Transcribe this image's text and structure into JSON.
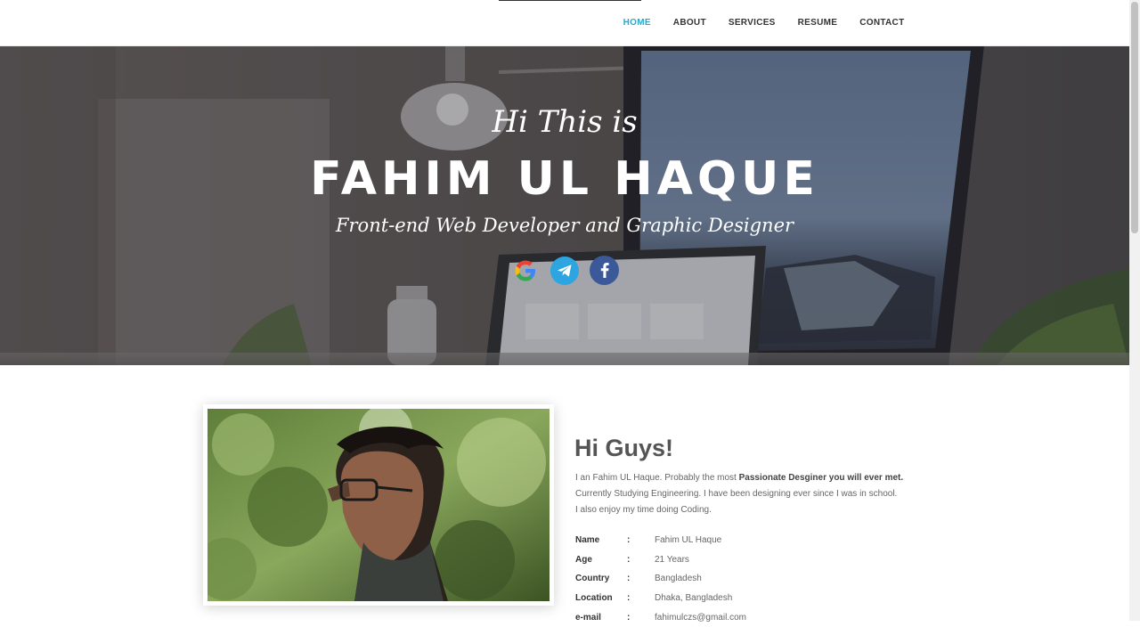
{
  "nav": {
    "items": [
      {
        "label": "HOME",
        "active": true
      },
      {
        "label": "ABOUT",
        "active": false
      },
      {
        "label": "SERVICES",
        "active": false
      },
      {
        "label": "RESUME",
        "active": false
      },
      {
        "label": "CONTACT",
        "active": false
      }
    ],
    "active_color": "#29a9c9"
  },
  "hero": {
    "greeting": "Hi This is",
    "name": "FAHIM UL HAQUE",
    "tagline": "Front-end Web Developer and Graphic Designer",
    "social": [
      "google-icon",
      "telegram-icon",
      "facebook-icon"
    ]
  },
  "about": {
    "title": "Hi Guys!",
    "intro_part1": "I an Fahim UL Haque. Probably the most ",
    "intro_bold": "Passionate Desginer you will ever met.",
    "intro_part2": " Currently Studying Engineering. I have been designing ever since I was in school.",
    "intro_line3": "I also enjoy my time doing Coding.",
    "colon": ":",
    "info": [
      {
        "label": "Name",
        "value": "Fahim UL Haque"
      },
      {
        "label": "Age",
        "value": "21 Years"
      },
      {
        "label": "Country",
        "value": "Bangladesh"
      },
      {
        "label": "Location",
        "value": "Dhaka, Bangladesh"
      },
      {
        "label": "e-mail",
        "value": "fahimulczs@gmail.com"
      }
    ]
  }
}
